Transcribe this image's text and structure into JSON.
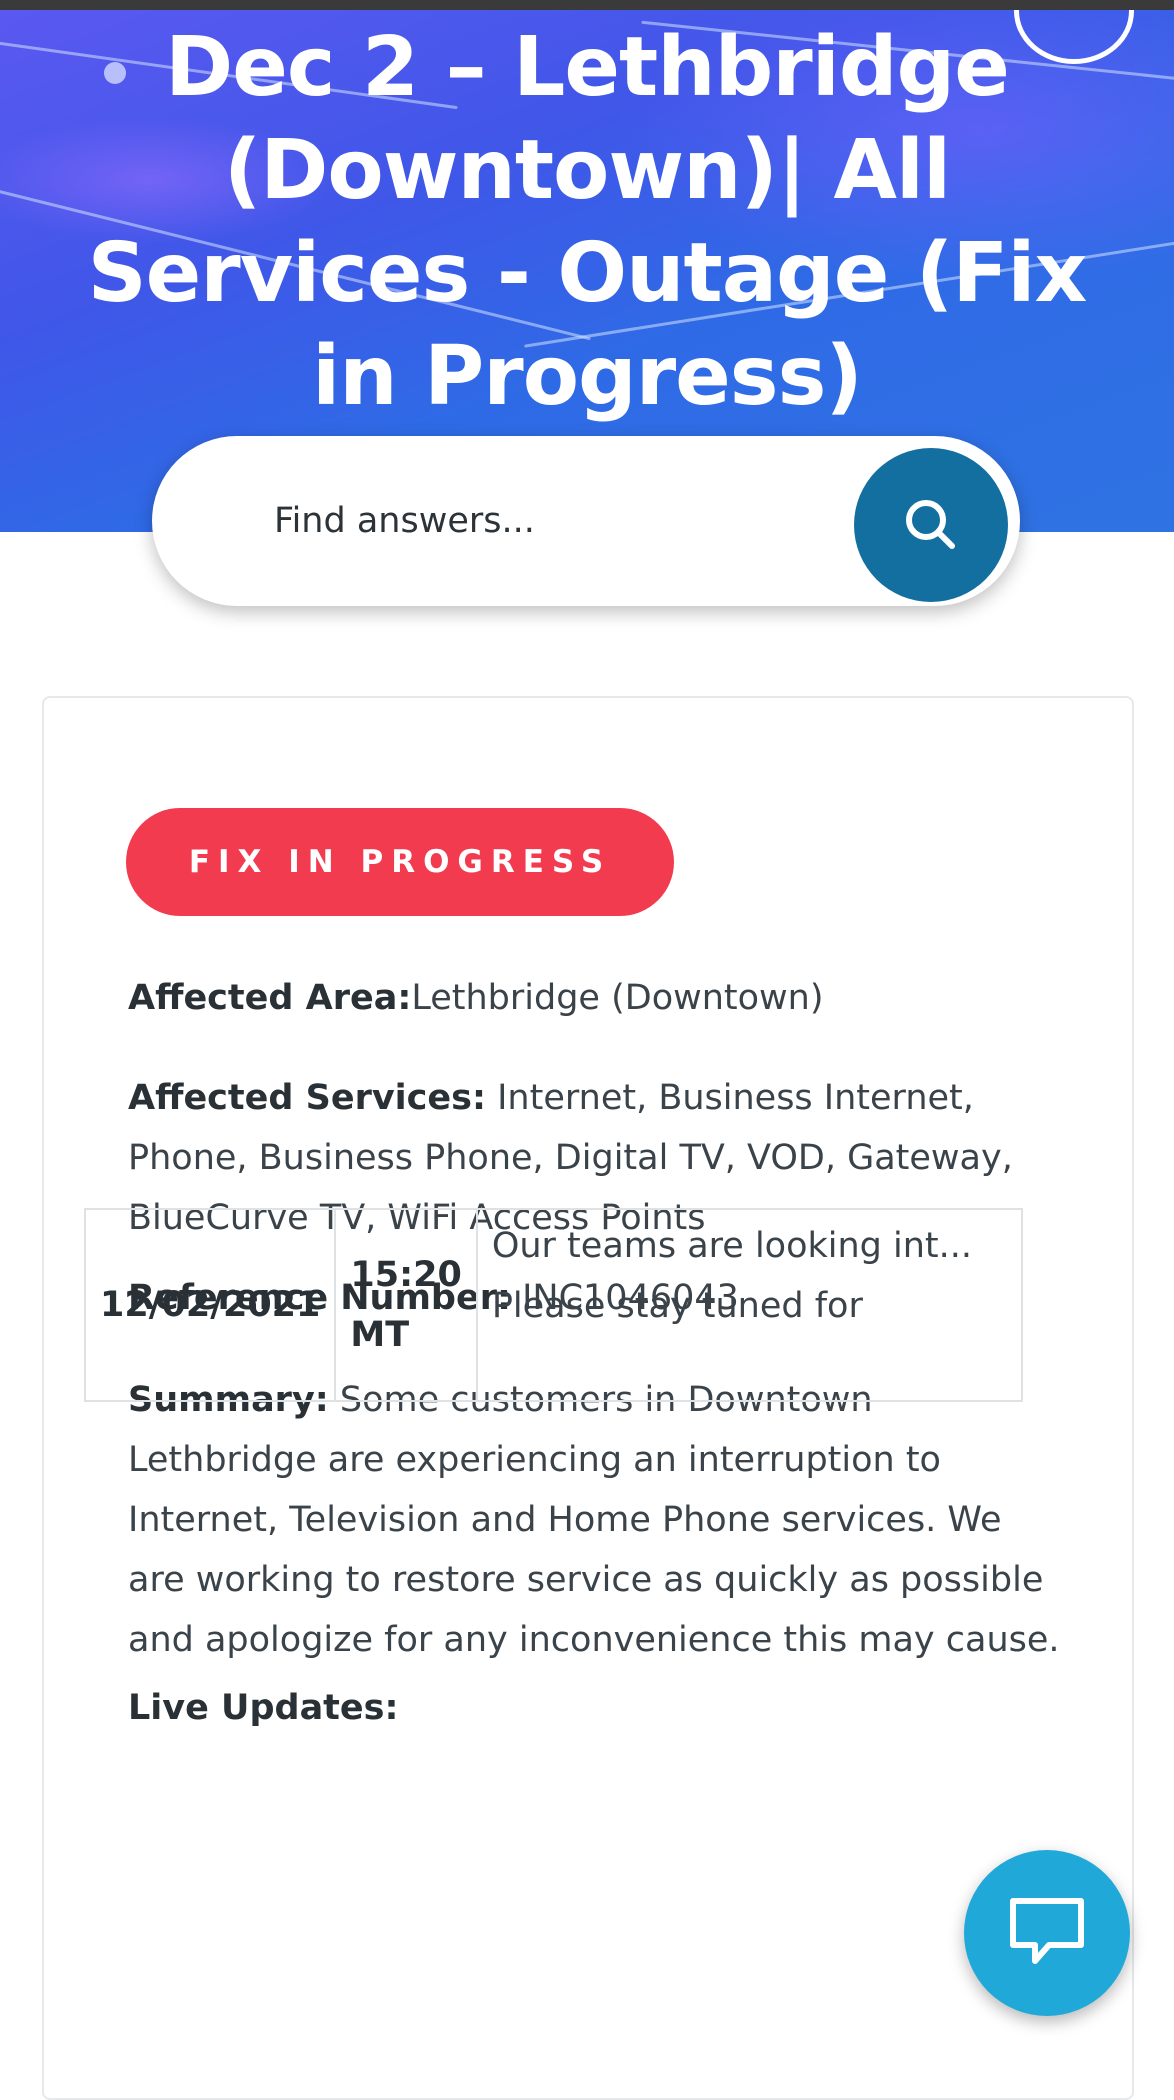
{
  "hero": {
    "title": "Dec 2 – Lethbridge (Downtown)| All Services - Outage (Fix in Progress)"
  },
  "search": {
    "placeholder": "Find answers...",
    "button_icon": "search-icon"
  },
  "incident": {
    "status_badge": "FIX IN PROGRESS",
    "affected_area_label": "Affected Area:",
    "affected_area_value": "Lethbridge (Downtown)",
    "affected_services_label": "Affected Services:",
    "affected_services_value": " Internet, Business Internet, Phone, Business Phone, Digital TV, VOD, Gateway, BlueCurve TV, WiFi Access Points",
    "reference_label": "Reference Number:",
    "reference_value": " INC1046043",
    "summary_label": "Summary:",
    "summary_value": " Some customers in Downtown Lethbridge are experiencing an interruption to Internet, Television and Home Phone services. We are working to restore service as quickly as possible and apologize for any inconvenience this may cause.",
    "live_updates_label": "Live Updates:",
    "updates": [
      {
        "date": "12/02/2021",
        "time": "15:20 MT",
        "message": "Our teams are looking int... Please stay tuned for"
      }
    ]
  },
  "chat": {
    "icon": "chat-bubble-icon"
  },
  "colors": {
    "hero_gradient_start": "#5a58f0",
    "hero_gradient_end": "#2f73e3",
    "search_button": "#136f9f",
    "badge": "#f23b4e",
    "chat_button": "#1fa8d8"
  }
}
